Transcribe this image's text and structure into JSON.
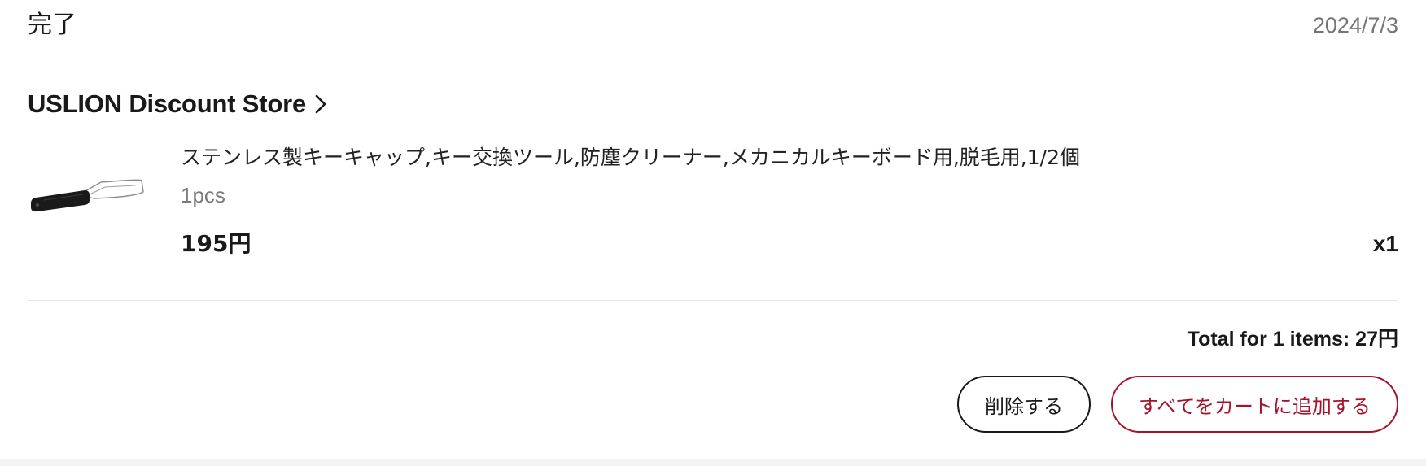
{
  "order": {
    "status": "完了",
    "date": "2024/7/3"
  },
  "store": {
    "name": "USLION Discount Store"
  },
  "item": {
    "title": "ステンレス製キーキャップ,キー交換ツール,防塵クリーナー,メカニカルキーボード用,脱毛用,1/2個",
    "variant": "1pcs",
    "price": "195円",
    "quantity": "x1"
  },
  "summary": {
    "total": "Total for 1 items: 27円"
  },
  "actions": {
    "delete_label": "削除する",
    "add_all_to_cart_label": "すべてをカートに追加する"
  },
  "colors": {
    "accent": "#a5122a",
    "text": "#191919",
    "muted": "#757575",
    "divider": "#e6e6e6"
  }
}
